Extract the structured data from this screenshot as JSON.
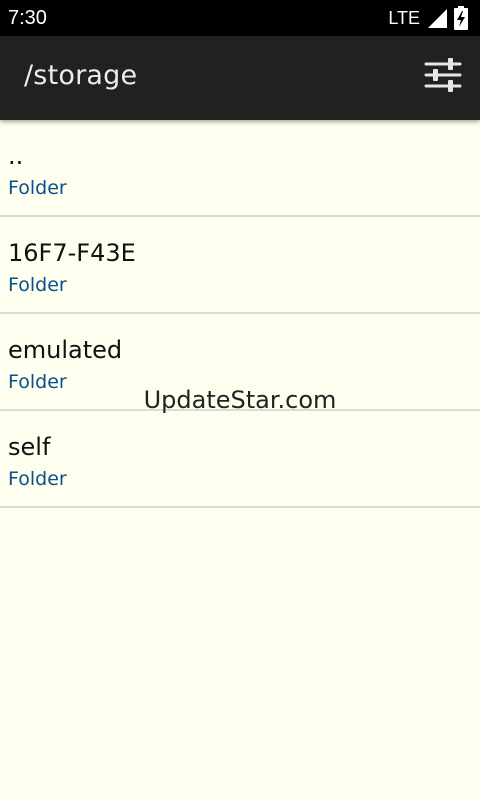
{
  "status_bar": {
    "time": "7:30",
    "network": "LTE",
    "icons": [
      "signal-icon",
      "battery-icon"
    ]
  },
  "app_bar": {
    "title": "/storage",
    "settings_icon": "sliders-icon"
  },
  "files": [
    {
      "name": "..",
      "type": "Folder"
    },
    {
      "name": "16F7-F43E",
      "type": "Folder"
    },
    {
      "name": "emulated",
      "type": "Folder"
    },
    {
      "name": "self",
      "type": "Folder"
    }
  ],
  "watermark": "UpdateStar.com",
  "colors": {
    "background": "#fffff0",
    "app_bar": "#212121",
    "folder_label": "#0b4f8c",
    "divider": "#dcdcd4"
  }
}
